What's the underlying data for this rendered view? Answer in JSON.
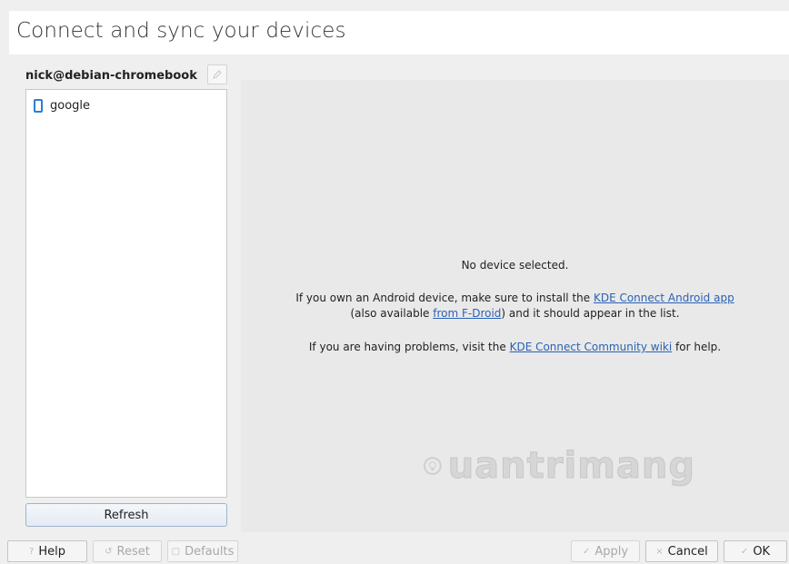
{
  "header": {
    "title": "Connect and sync your devices"
  },
  "sidebar": {
    "device_name": "nick@debian-chromebook",
    "devices": [
      {
        "label": "google"
      }
    ],
    "refresh_label": "Refresh"
  },
  "main": {
    "no_device": "No device selected.",
    "android_prefix": "If you own an Android device, make sure to install the ",
    "android_link": "KDE Connect Android app",
    "android_mid": " (also available ",
    "fdroid_link": "from F-Droid",
    "android_suffix": ") and it should appear in the list.",
    "problems_prefix": "If you are having problems, visit the ",
    "wiki_link": "KDE Connect Community wiki",
    "problems_suffix": " for help.",
    "watermark": "uantrimang",
    "link_color": "#2a62b5"
  },
  "footer": {
    "help_label": "Help",
    "reset_label": "Reset",
    "defaults_label": "Defaults",
    "apply_label": "Apply",
    "cancel_label": "Cancel",
    "ok_label": "OK"
  }
}
